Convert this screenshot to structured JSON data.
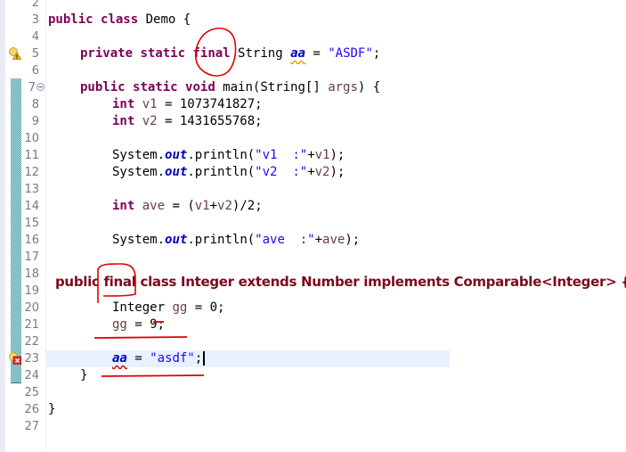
{
  "editor": {
    "line_numbers": [
      "2",
      "3",
      "4",
      "5",
      "6",
      "7",
      "8",
      "9",
      "10",
      "11",
      "12",
      "13",
      "14",
      "15",
      "16",
      "17",
      "18",
      "19",
      "20",
      "21",
      "22",
      "23",
      "24",
      "25",
      "26",
      "27"
    ],
    "lines": {
      "l3": {
        "kw1": "public",
        "kw2": "class",
        "rest": " Demo {"
      },
      "l5": {
        "kw1": "private",
        "kw2": "static",
        "kw3": "final",
        "type": " String ",
        "field": "aa",
        "eq": " = ",
        "str": "\"ASDF\"",
        "end": ";"
      },
      "l7": {
        "kw1": "public",
        "kw2": "static",
        "kw3": "void",
        "rest1": " main(String[] ",
        "param": "args",
        "rest2": ") {"
      },
      "l8": {
        "kw": "int",
        "var": "v1",
        "rest": " = 1073741827;"
      },
      "l9": {
        "kw": "int",
        "var": "v2",
        "rest": " = 1431655768;"
      },
      "l11": {
        "pre": "System.",
        "field": "out",
        "mid": ".println(",
        "str": "\"v1  :\"",
        "plus": "+",
        "var": "v1",
        "end": ");"
      },
      "l12": {
        "pre": "System.",
        "field": "out",
        "mid": ".println(",
        "str": "\"v2  :\"",
        "plus": "+",
        "var": "v2",
        "end": ");"
      },
      "l14": {
        "kw": "int",
        "var": "ave",
        "rest1": " = (",
        "v1": "v1",
        "plus": "+",
        "v2": "v2",
        "rest2": ")/2;"
      },
      "l16": {
        "pre": "System.",
        "field": "out",
        "mid": ".println(",
        "str": "\"ave  :\"",
        "plus": "+",
        "var": "ave",
        "end": ");"
      },
      "l20": {
        "type": "Integer ",
        "var": "gg",
        "rest": " = 0;"
      },
      "l21": {
        "var": "gg",
        "rest": " = 9;"
      },
      "l23": {
        "field": "aa",
        "eq": " = ",
        "str": "\"asdf\"",
        "end": ";"
      },
      "l24": {
        "text": "}"
      },
      "l26": {
        "text": "}"
      }
    },
    "overlay_declaration": "public final class Integer extends Number implements Comparable<Integer> {",
    "markers": {
      "line5": "warning-icon",
      "line7": "fold-collapse-icon",
      "line23": "error-icon"
    }
  },
  "colors": {
    "keyword": "#7f0055",
    "string": "#2a00ff",
    "field": "#0000c0",
    "local_var": "#6a3e3e",
    "annotation": "#e00000",
    "overlay_text": "#7b0a1e",
    "current_line": "#e8f2fe"
  }
}
